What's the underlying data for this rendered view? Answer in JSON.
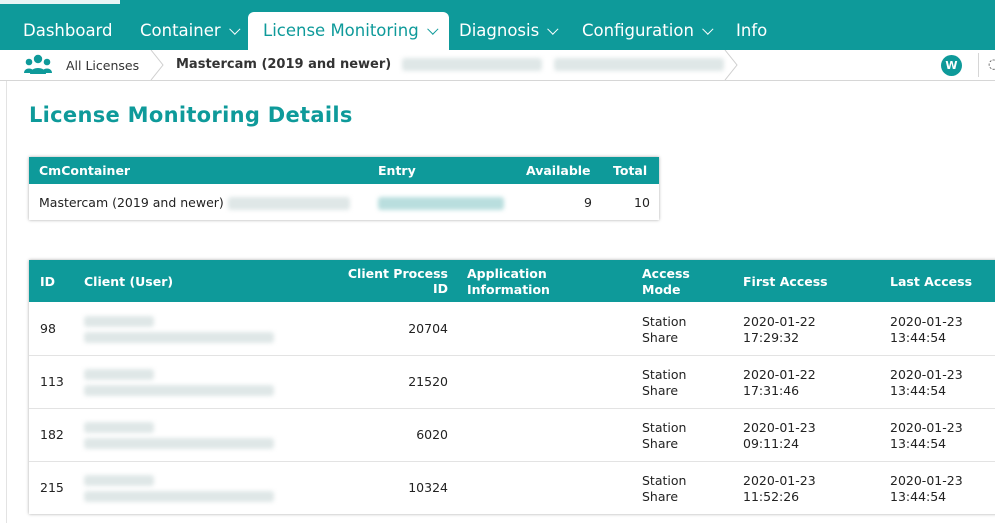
{
  "nav": {
    "items": [
      {
        "label": "Dashboard",
        "dropdown": false
      },
      {
        "label": "Container",
        "dropdown": true
      },
      {
        "label": "License Monitoring",
        "dropdown": true,
        "active": true
      },
      {
        "label": "Diagnosis",
        "dropdown": true
      },
      {
        "label": "Configuration",
        "dropdown": true
      },
      {
        "label": "Info",
        "dropdown": false
      }
    ]
  },
  "breadcrumb": {
    "icon": "users-icon",
    "all_label": "All Licenses",
    "current_label": "Mastercam (2019 and newer)"
  },
  "user": {
    "avatar_letter": "W"
  },
  "page": {
    "title": "License Monitoring Details"
  },
  "summary_table": {
    "headers": [
      "CmContainer",
      "Entry",
      "Available",
      "Total"
    ],
    "row": {
      "container": "Mastercam (2019 and newer)",
      "available": "9",
      "total": "10"
    }
  },
  "access_table": {
    "headers": {
      "id": "ID",
      "client": "Client (User)",
      "pid_line1": "Client Process",
      "pid_line2": "ID",
      "app_line1": "Application",
      "app_line2": "Information",
      "mode_line1": "Access",
      "mode_line2": "Mode",
      "first": "First Access",
      "last": "Last Access"
    },
    "rows": [
      {
        "id": "98",
        "pid": "20704",
        "mode1": "Station",
        "mode2": "Share",
        "first_date": "2020-01-22",
        "first_time": "17:29:32",
        "last_date": "2020-01-23",
        "last_time": "13:44:54"
      },
      {
        "id": "113",
        "pid": "21520",
        "mode1": "Station",
        "mode2": "Share",
        "first_date": "2020-01-22",
        "first_time": "17:31:46",
        "last_date": "2020-01-23",
        "last_time": "13:44:54"
      },
      {
        "id": "182",
        "pid": "6020",
        "mode1": "Station",
        "mode2": "Share",
        "first_date": "2020-01-23",
        "first_time": "09:11:24",
        "last_date": "2020-01-23",
        "last_time": "13:44:54"
      },
      {
        "id": "215",
        "pid": "10324",
        "mode1": "Station",
        "mode2": "Share",
        "first_date": "2020-01-23",
        "first_time": "11:52:26",
        "last_date": "2020-01-23",
        "last_time": "13:44:54"
      }
    ]
  },
  "colors": {
    "accent": "#0e9a9a"
  }
}
